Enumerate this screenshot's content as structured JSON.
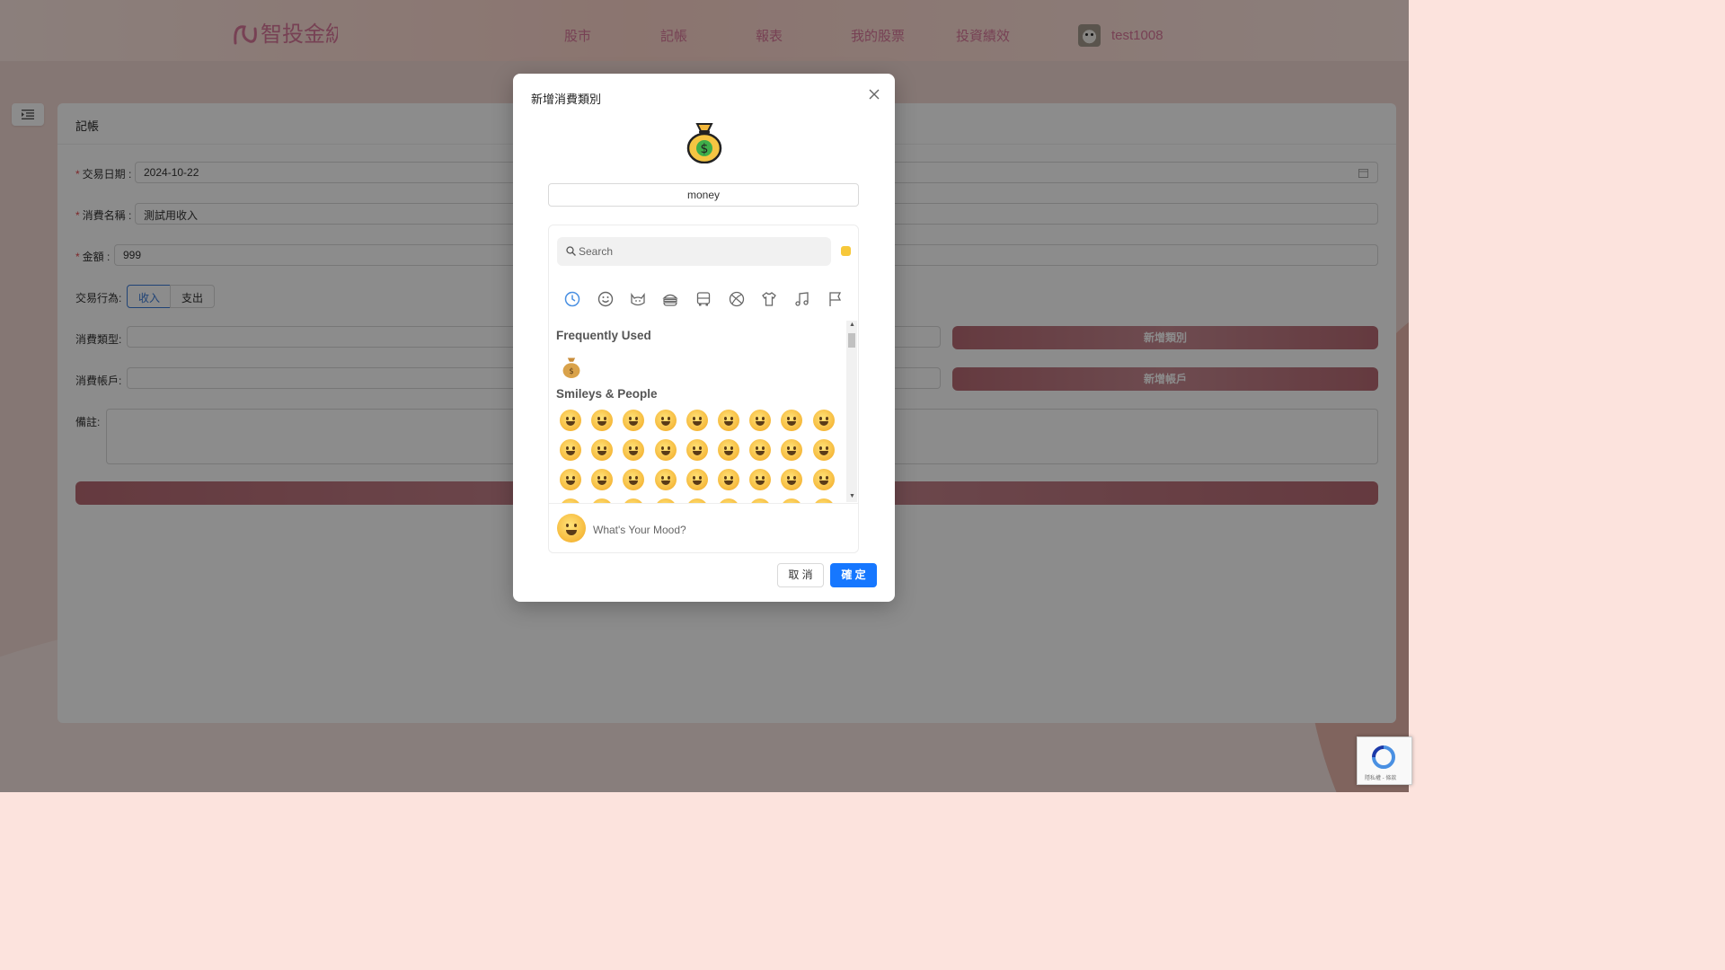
{
  "nav": {
    "logo_text": "智投金紡",
    "links": [
      "股市",
      "記帳",
      "報表",
      "我的股票",
      "投資績效"
    ],
    "username": "test1008"
  },
  "form": {
    "title": "記帳",
    "date_label": "交易日期",
    "date_value": "2024-10-22",
    "name_label": "消費名稱",
    "name_value": "測試用收入",
    "amount_label": "金額",
    "amount_value": "999",
    "action_label": "交易行為:",
    "action_options": [
      "收入",
      "支出"
    ],
    "action_selected": "收入",
    "category_label": "消費類型:",
    "account_label": "消費帳戶:",
    "add_category_button": "新增類別",
    "add_account_button": "新增帳戶",
    "note_label": "備註:"
  },
  "modal": {
    "title": "新增消費類別",
    "selected_emoji": "moneybag",
    "name_value": "money",
    "picker": {
      "search_placeholder": "Search",
      "skin_tone_color": "#f7c83a",
      "categories": [
        "recent",
        "smileys",
        "animals",
        "food",
        "travel",
        "activities",
        "objects",
        "symbols",
        "flags"
      ],
      "sections": {
        "frequently_used": "Frequently Used",
        "smileys_people": "Smileys & People"
      },
      "frequently_used": [
        "moneybag"
      ],
      "mood_placeholder": "What's Your Mood?"
    },
    "cancel_button": "取 消",
    "confirm_button": "確 定"
  },
  "recaptcha": {
    "text": "隱私權 - 條款"
  },
  "colors": {
    "nav_text": "#d9779a",
    "primary": "#1677ff",
    "brown_button": "#b86a74"
  }
}
